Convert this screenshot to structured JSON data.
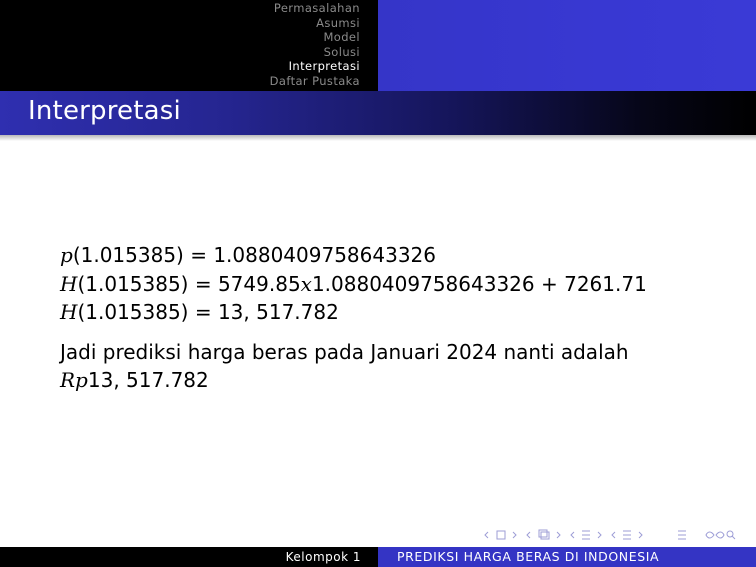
{
  "header": {
    "nav_items": [
      {
        "label": "Permasalahan",
        "active": false
      },
      {
        "label": "Asumsi",
        "active": false
      },
      {
        "label": "Model",
        "active": false
      },
      {
        "label": "Solusi",
        "active": false
      },
      {
        "label": "Interpretasi",
        "active": true
      },
      {
        "label": "Daftar Pustaka",
        "active": false
      }
    ]
  },
  "title": "Interpretasi",
  "content": {
    "line1": {
      "fn": "p",
      "rest": "(1.015385) = 1.0880409758643326"
    },
    "line2": {
      "fn": "H",
      "mid": "(1.015385) = 5749.85",
      "var": "x",
      "rest": "1.0880409758643326 + 7261.71"
    },
    "line3": {
      "fn": "H",
      "rest": "(1.015385) = 13, 517.782"
    },
    "paragraph_line1": "Jadi prediksi harga beras pada Januari 2024 nanti adalah",
    "paragraph_rp": "Rp",
    "paragraph_value": "13, 517.782"
  },
  "footer": {
    "author": "Kelompok 1",
    "title": "PREDIKSI HARGA BERAS DI INDONESIA"
  },
  "colors": {
    "accent_blue": "#3434c4",
    "header_left": "#000000",
    "nav_active": "#ffffff",
    "nav_inactive": "#8a8a8a"
  },
  "nav_symbols": [
    "arrow-left-icon",
    "frame-icon",
    "arrow-right-icon",
    "subsection-icon",
    "section-icon",
    "align-icon",
    "search-icon"
  ]
}
